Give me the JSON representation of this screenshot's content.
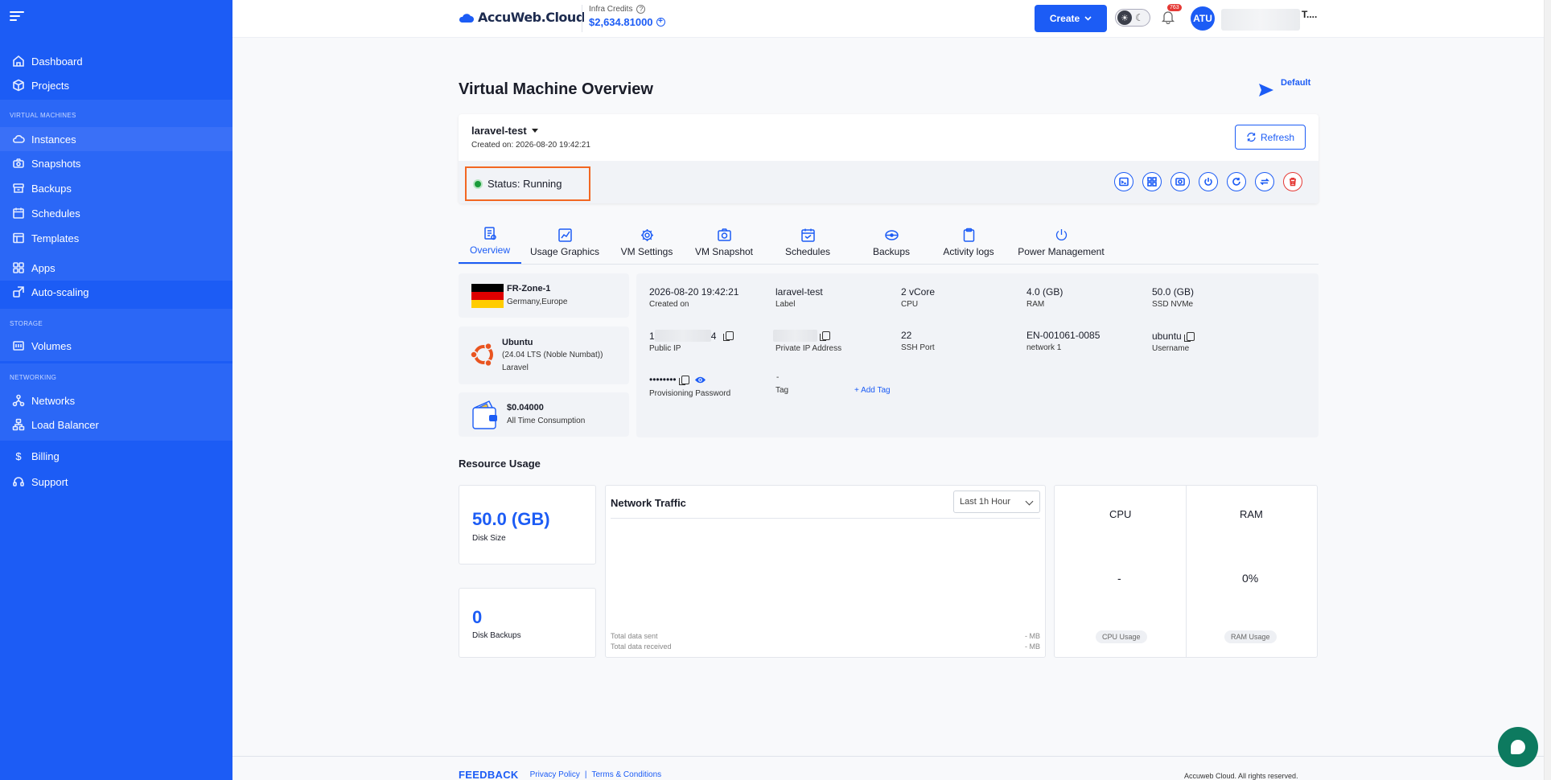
{
  "sidebar": {
    "items": [
      {
        "label": "Dashboard",
        "icon": "home-icon"
      },
      {
        "label": "Projects",
        "icon": "cube-icon"
      },
      {
        "label": "Instances",
        "icon": "cloud-icon",
        "active": true
      },
      {
        "label": "Snapshots",
        "icon": "camera-icon"
      },
      {
        "label": "Backups",
        "icon": "archive-icon"
      },
      {
        "label": "Schedules",
        "icon": "calendar-icon"
      },
      {
        "label": "Templates",
        "icon": "template-icon"
      },
      {
        "label": "Apps",
        "icon": "grid-icon"
      },
      {
        "label": "Auto-scaling",
        "icon": "scale-icon"
      },
      {
        "label": "Volumes",
        "icon": "volume-icon"
      },
      {
        "label": "Networks",
        "icon": "network-icon"
      },
      {
        "label": "Load Balancer",
        "icon": "balancer-icon"
      },
      {
        "label": "Billing",
        "icon": "dollar-icon"
      },
      {
        "label": "Support",
        "icon": "headset-icon"
      }
    ],
    "sections": {
      "virtual_machines": "VIRTUAL MACHINES",
      "storage": "STORAGE",
      "networking": "NETWORKING"
    }
  },
  "header": {
    "brand": "AccuWeb.Cloud",
    "credits_label": "Infra Credits",
    "credits_amount": "$2,634.81000",
    "create_label": "Create",
    "notification_count": "763",
    "avatar_initials": "ATU",
    "user_name": "T...."
  },
  "page": {
    "title": "Virtual Machine Overview",
    "project": "Default"
  },
  "vm": {
    "name": "laravel-test",
    "created": "Created on: 2026-08-20 19:42:21",
    "refresh_label": "Refresh",
    "status": "Status: Running"
  },
  "tabs": [
    {
      "label": "Overview",
      "icon": "document-icon",
      "active": true
    },
    {
      "label": "Usage Graphics",
      "icon": "chart-icon"
    },
    {
      "label": "VM Settings",
      "icon": "gear-icon"
    },
    {
      "label": "VM Snapshot",
      "icon": "snapshot-icon"
    },
    {
      "label": "Schedules",
      "icon": "calendar-icon"
    },
    {
      "label": "Backups",
      "icon": "backup-icon"
    },
    {
      "label": "Activity logs",
      "icon": "clipboard-icon"
    },
    {
      "label": "Power Management",
      "icon": "power-icon"
    }
  ],
  "info": {
    "zone": "FR-Zone-1",
    "zone_region": "Germany,Europe",
    "os_name": "Ubuntu",
    "os_version": "(24.04 LTS (Noble Numbat))",
    "os_app": "Laravel",
    "consumption_amount": "$0.04000",
    "consumption_label": "All Time Consumption"
  },
  "details": {
    "created_on": {
      "value": "2026-08-20 19:42:21",
      "label": "Created on"
    },
    "label": {
      "value": "laravel-test",
      "label": "Label"
    },
    "cpu": {
      "value": "2 vCore",
      "label": "CPU"
    },
    "ram": {
      "value": "4.0 (GB)",
      "label": "RAM"
    },
    "ssd": {
      "value": "50.0 (GB)",
      "label": "SSD NVMe"
    },
    "public_ip": {
      "prefix": "1",
      "suffix": "4",
      "label": "Public IP"
    },
    "private_ip": {
      "label": "Private IP Address"
    },
    "ssh_port": {
      "value": "22",
      "label": "SSH Port"
    },
    "network": {
      "value": "EN-001061-0085",
      "label": "network 1"
    },
    "username": {
      "value": "ubuntu",
      "label": "Username"
    },
    "password": {
      "value": "••••••••",
      "label": "Provisioning Password"
    },
    "tag": {
      "value": "-",
      "label": "Tag",
      "add": "+ Add Tag"
    }
  },
  "resources": {
    "title": "Resource Usage",
    "disk_size": "50.0 (GB)",
    "disk_size_label": "Disk Size",
    "disk_backups": "0",
    "disk_backups_label": "Disk Backups",
    "network_title": "Network Traffic",
    "range": "Last 1h Hour",
    "sent_label": "Total data sent",
    "sent_value": "- MB",
    "received_label": "Total data received",
    "received_value": "- MB",
    "cpu_title": "CPU",
    "cpu_value": "-",
    "cpu_pill": "CPU Usage",
    "ram_title": "RAM",
    "ram_value": "0%",
    "ram_pill": "RAM Usage"
  },
  "footer": {
    "feedback": "FEEDBACK",
    "privacy": "Privacy Policy",
    "separator": "|",
    "terms": "Terms & Conditions",
    "rights": "Accuweb Cloud. All rights reserved."
  },
  "colors": {
    "accent": "#1c5cf5",
    "status_running": "#1a9b3a",
    "highlight": "#f26722",
    "danger": "#e53935"
  }
}
